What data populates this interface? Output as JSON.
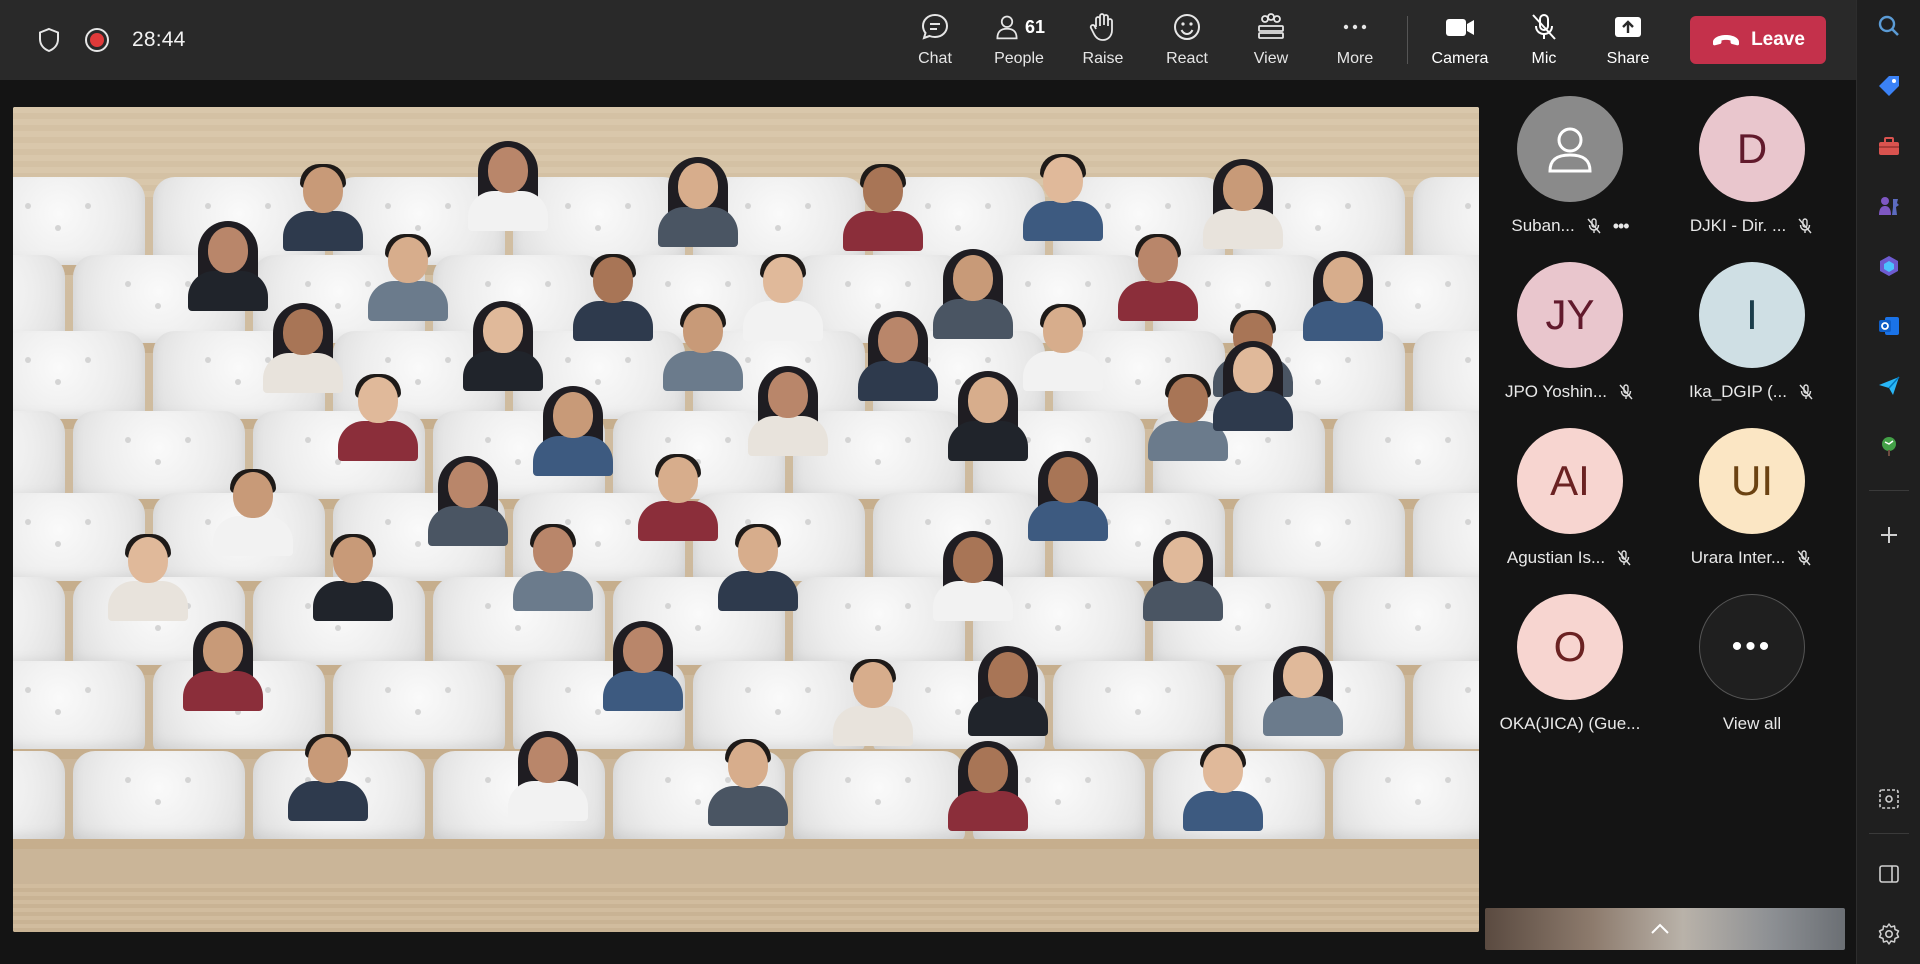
{
  "topbar": {
    "timer": "28:44",
    "controls": [
      {
        "id": "chat",
        "label": "Chat",
        "icon": "chat-icon"
      },
      {
        "id": "people",
        "label": "People",
        "icon": "people-icon",
        "count": "61"
      },
      {
        "id": "raise",
        "label": "Raise",
        "icon": "raise-hand-icon"
      },
      {
        "id": "react",
        "label": "React",
        "icon": "react-icon"
      },
      {
        "id": "view",
        "label": "View",
        "icon": "view-icon"
      },
      {
        "id": "more",
        "label": "More",
        "icon": "more-icon"
      },
      {
        "id": "camera",
        "label": "Camera",
        "icon": "camera-icon"
      },
      {
        "id": "mic",
        "label": "Mic",
        "icon": "mic-off-icon"
      },
      {
        "id": "share",
        "label": "Share",
        "icon": "share-icon"
      }
    ],
    "leave_label": "Leave"
  },
  "participants": [
    {
      "initials": "",
      "name": "Suban...",
      "color": "#8a8a8a",
      "icon": "person-icon",
      "muted": true,
      "has_more": true
    },
    {
      "initials": "D",
      "name": "DJKI - Dir. ...",
      "color": "#e9c6cd",
      "muted": true
    },
    {
      "initials": "JY",
      "name": "JPO Yoshin...",
      "color": "#e9c6cd",
      "muted": true
    },
    {
      "initials": "I",
      "name": "Ika_DGIP (...",
      "color": "#cfdfe4",
      "muted": true
    },
    {
      "initials": "AI",
      "name": "Agustian Is...",
      "color": "#f7d5d0",
      "muted": true
    },
    {
      "initials": "UI",
      "name": "Urara Inter...",
      "color": "#fbe6c4",
      "muted": true
    },
    {
      "initials": "O",
      "name": "OKA(JICA) (Gue...",
      "color": "#f7d5d0",
      "muted": false
    }
  ],
  "view_all": {
    "label": "View all",
    "icon": "more-icon"
  },
  "rail": [
    "search-icon",
    "tag-icon",
    "toolbox-icon",
    "chess-icon",
    "copilot-icon",
    "outlook-icon",
    "send-icon",
    "plant-icon",
    "add-icon",
    "screenshot-icon",
    "panel-icon",
    "settings-icon"
  ]
}
